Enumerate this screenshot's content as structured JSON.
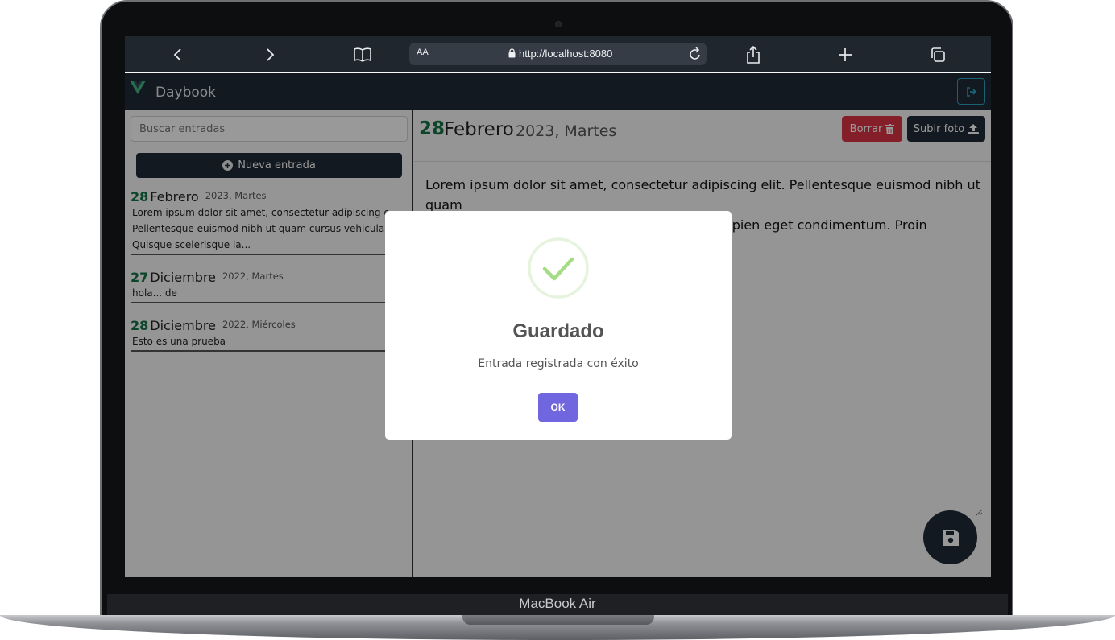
{
  "device": {
    "label": "MacBook Air"
  },
  "browser": {
    "text_size_label": "AA",
    "url": "http://localhost:8080"
  },
  "app": {
    "brand": "Daybook"
  },
  "sidebar": {
    "search_placeholder": "Buscar entradas",
    "new_entry_label": "Nueva entrada",
    "entries": [
      {
        "day": "28",
        "month": "Febrero",
        "year_weekday": "2023, Martes",
        "lines": [
          "Lorem ipsum dolor sit amet, consectetur adipiscing e",
          "Pellentesque euismod nibh ut quam cursus vehicula.",
          "Quisque scelerisque la..."
        ]
      },
      {
        "day": "27",
        "month": "Diciembre",
        "year_weekday": "2022, Martes",
        "lines": [
          "hola... de"
        ]
      },
      {
        "day": "28",
        "month": "Diciembre",
        "year_weekday": "2022, Miércoles",
        "lines": [
          "Esto es una prueba"
        ]
      }
    ]
  },
  "entry_view": {
    "day": "28",
    "month": "Febrero",
    "year_weekday": "2023, Martes",
    "delete_label": "Borrar",
    "upload_label": "Subir foto",
    "text_line1": "Lorem ipsum dolor sit amet, consectetur adipiscing elit. Pellentesque euismod nibh ut quam",
    "text_line2": "cursus vehicula. Quisque scelerisque laoreet sapien eget condimentum. Proin malesuada"
  },
  "modal": {
    "title": "Guardado",
    "text": "Entrada registrada con éxito",
    "ok_label": "OK",
    "icon": "success-check-icon",
    "accent": "#7066e0",
    "check_color": "#a5dc86"
  },
  "colors": {
    "navbar": "#212b36",
    "day_green": "#157347",
    "delete_red": "#dc3545",
    "logout_cyan": "#29a3c3"
  }
}
